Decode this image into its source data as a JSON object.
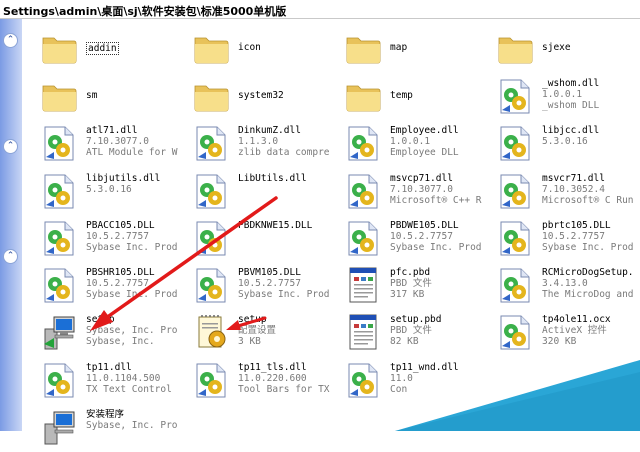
{
  "address_bar": {
    "path": "Settings\\admin\\桌面\\sj\\软件安装包\\标准5000单机版"
  },
  "files": [
    {
      "name": "addin",
      "line2": "",
      "line3": "",
      "icon": "folder-icon",
      "kind": "folder",
      "col": 0,
      "row": 0
    },
    {
      "name": "icon",
      "line2": "",
      "line3": "",
      "icon": "folder-icon",
      "kind": "folder",
      "col": 1,
      "row": 0
    },
    {
      "name": "map",
      "line2": "",
      "line3": "",
      "icon": "folder-icon",
      "kind": "folder",
      "col": 2,
      "row": 0
    },
    {
      "name": "sjexe",
      "line2": "",
      "line3": "",
      "icon": "folder-icon",
      "kind": "folder",
      "col": 3,
      "row": 0
    },
    {
      "name": "sm",
      "line2": "",
      "line3": "",
      "icon": "folder-icon",
      "kind": "folder",
      "col": 0,
      "row": 1
    },
    {
      "name": "system32",
      "line2": "",
      "line3": "",
      "icon": "folder-icon",
      "kind": "folder",
      "col": 1,
      "row": 1
    },
    {
      "name": "temp",
      "line2": "",
      "line3": "",
      "icon": "folder-icon",
      "kind": "folder",
      "col": 2,
      "row": 1
    },
    {
      "name": "_wshom.dll",
      "line2": "1.0.0.1",
      "line3": "_wshom DLL",
      "icon": "dll-gear-icon",
      "kind": "dll",
      "col": 3,
      "row": 1
    },
    {
      "name": "atl71.dll",
      "line2": "7.10.3077.0",
      "line3": "ATL Module for W...",
      "icon": "dll-gear-icon",
      "kind": "dll",
      "col": 0,
      "row": 2
    },
    {
      "name": "DinkumZ.dll",
      "line2": "1.1.3.0",
      "line3": "zlib data compre...",
      "icon": "dll-gear-icon",
      "kind": "dll",
      "col": 1,
      "row": 2
    },
    {
      "name": "Employee.dll",
      "line2": "1.0.0.1",
      "line3": "Employee DLL",
      "icon": "dll-gear-icon",
      "kind": "dll",
      "col": 2,
      "row": 2
    },
    {
      "name": "libjcc.dll",
      "line2": "5.3.0.16",
      "line3": "",
      "icon": "dll-gear-icon",
      "kind": "dll",
      "col": 3,
      "row": 2
    },
    {
      "name": "libjutils.dll",
      "line2": "5.3.0.16",
      "line3": "",
      "icon": "dll-gear-icon",
      "kind": "dll",
      "col": 0,
      "row": 3
    },
    {
      "name": "LibUtils.dll",
      "line2": "",
      "line3": "",
      "icon": "dll-gear-icon",
      "kind": "dll",
      "col": 1,
      "row": 3
    },
    {
      "name": "msvcp71.dll",
      "line2": "7.10.3077.0",
      "line3": "Microsoft® C++ R...",
      "icon": "dll-gear-icon",
      "kind": "dll",
      "col": 2,
      "row": 3
    },
    {
      "name": "msvcr71.dll",
      "line2": "7.10.3052.4",
      "line3": "Microsoft® C Run...",
      "icon": "dll-gear-icon",
      "kind": "dll",
      "col": 3,
      "row": 3
    },
    {
      "name": "PBACC105.DLL",
      "line2": "10.5.2.7757",
      "line3": "Sybase Inc. Prod...",
      "icon": "dll-gear-icon",
      "kind": "dll",
      "col": 0,
      "row": 4
    },
    {
      "name": "PBDKNWE15.DLL",
      "line2": "",
      "line3": "",
      "icon": "dll-gear-icon",
      "kind": "dll",
      "col": 1,
      "row": 4
    },
    {
      "name": "PBDWE105.DLL",
      "line2": "10.5.2.7757",
      "line3": "Sybase Inc. Prod...",
      "icon": "dll-gear-icon",
      "kind": "dll",
      "col": 2,
      "row": 4
    },
    {
      "name": "pbrtc105.DLL",
      "line2": "10.5.2.7757",
      "line3": "Sybase Inc. Prod...",
      "icon": "dll-gear-icon",
      "kind": "dll",
      "col": 3,
      "row": 4
    },
    {
      "name": "PBSHR105.DLL",
      "line2": "10.5.2.7757",
      "line3": "Sybase Inc. Prod...",
      "icon": "dll-gear-icon",
      "kind": "dll",
      "col": 0,
      "row": 5
    },
    {
      "name": "PBVM105.DLL",
      "line2": "10.5.2.7757",
      "line3": "Sybase Inc. Prod...",
      "icon": "dll-gear-icon",
      "kind": "dll",
      "col": 1,
      "row": 5
    },
    {
      "name": "pfc.pbd",
      "line2": "PBD 文件",
      "line3": "317 KB",
      "icon": "pbd-file-icon",
      "kind": "pbd",
      "col": 2,
      "row": 5
    },
    {
      "name": "RCMicroDogSetup.dll",
      "line2": "3.4.13.0",
      "line3": "The MicroDog and...",
      "icon": "dll-gear-icon",
      "kind": "dll",
      "col": 3,
      "row": 5
    },
    {
      "name": "setup",
      "line2": "Sybase, Inc. Pro...",
      "line3": "Sybase, Inc.",
      "icon": "setup-computer-icon",
      "kind": "setup",
      "col": 0,
      "row": 6
    },
    {
      "name": "setup",
      "line2": "配置设置",
      "line3": "3 KB",
      "icon": "config-settings-icon",
      "kind": "config",
      "col": 1,
      "row": 6
    },
    {
      "name": "setup.pbd",
      "line2": "PBD 文件",
      "line3": "82 KB",
      "icon": "pbd-file-icon",
      "kind": "pbd",
      "col": 2,
      "row": 6
    },
    {
      "name": "tp4ole11.ocx",
      "line2": "ActiveX 控件",
      "line3": "320 KB",
      "icon": "dll-gear-icon",
      "kind": "dll",
      "col": 3,
      "row": 6
    },
    {
      "name": "tp11.dll",
      "line2": "11.0.1104.500",
      "line3": "TX Text Control ...",
      "icon": "dll-gear-icon",
      "kind": "dll",
      "col": 0,
      "row": 7
    },
    {
      "name": "tp11_tls.dll",
      "line2": "11.0.220.600",
      "line3": "Tool Bars for TX...",
      "icon": "dll-gear-icon",
      "kind": "dll",
      "col": 1,
      "row": 7
    },
    {
      "name": "tp11_wnd.dll",
      "line2": "11.0",
      "line3": "Con",
      "icon": "dll-gear-icon",
      "kind": "dll",
      "col": 2,
      "row": 7
    },
    {
      "name": "安装程序",
      "line2": "Sybase, Inc. Pro...",
      "line3": "",
      "icon": "installer-icon",
      "kind": "setup",
      "col": 0,
      "row": 8
    }
  ],
  "colors": {
    "arrow": "#e21a1a",
    "wedge": "#2aa6d6",
    "pane": "#7b9be4"
  }
}
